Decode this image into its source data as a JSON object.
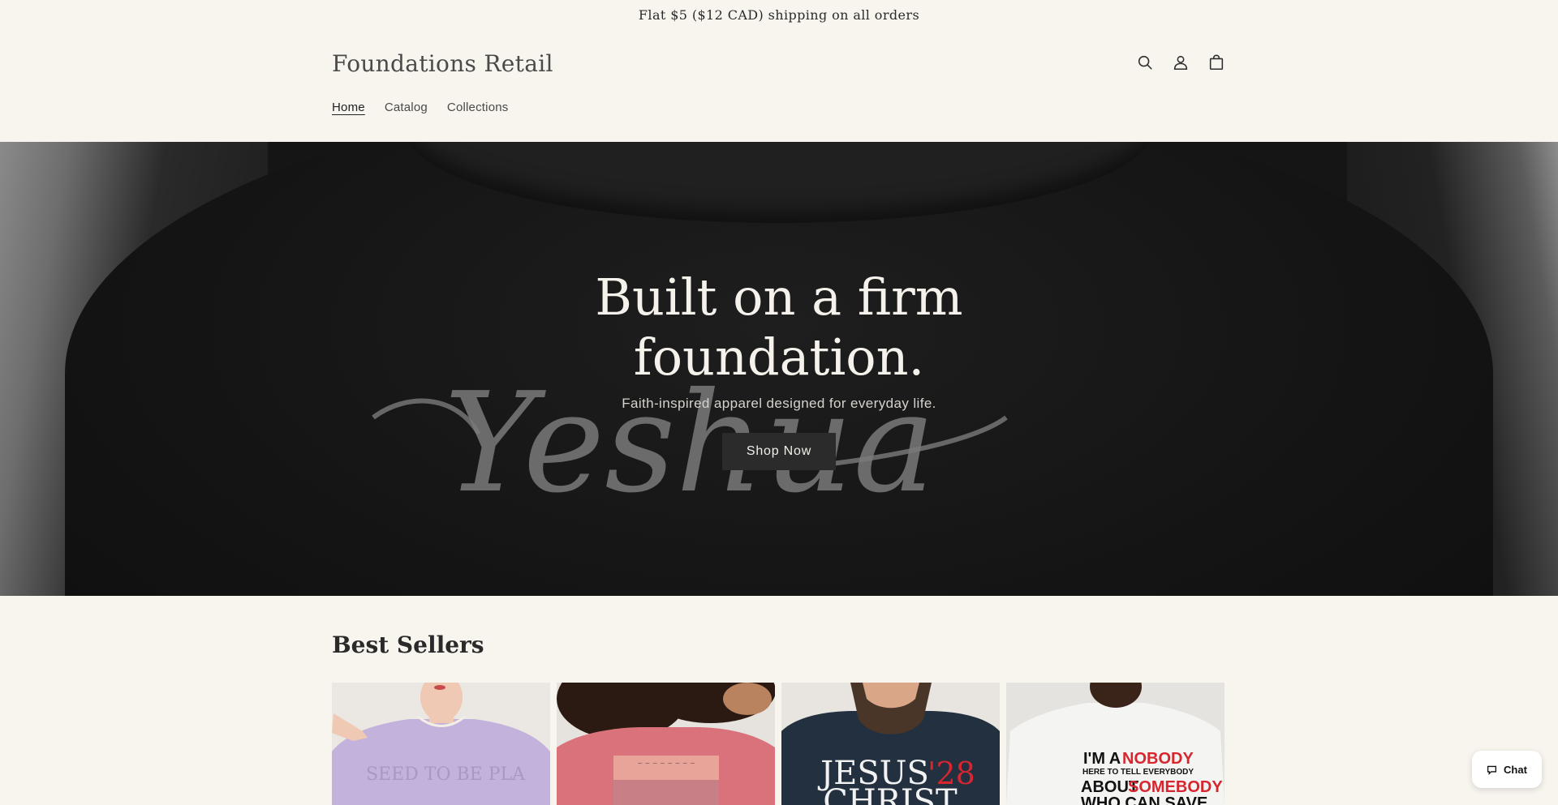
{
  "announcement": "Flat $5 ($12 CAD) shipping on all orders",
  "brand": "Foundations Retail",
  "nav": {
    "items": [
      {
        "label": "Home",
        "active": true
      },
      {
        "label": "Catalog",
        "active": false
      },
      {
        "label": "Collections",
        "active": false
      }
    ]
  },
  "header_icons": [
    "search-icon",
    "account-icon",
    "cart-icon"
  ],
  "hero": {
    "title_line1": "Built on a firm",
    "title_line2": "foundation.",
    "subtitle": "Faith-inspired apparel designed for everyday life.",
    "button": "Shop Now",
    "shirt_script": "Yeshua"
  },
  "best_sellers": {
    "title": "Best Sellers",
    "products": [
      {
        "image": "lavender-tee",
        "print": "SEED TO BE PLA",
        "color": "#c3b2dc"
      },
      {
        "image": "pink-tee",
        "color": "#d9727a"
      },
      {
        "image": "navy-tee",
        "print_line1": "JESUS",
        "print_accent": "'28",
        "print_line2": "CHRIST",
        "color": "#22303f"
      },
      {
        "image": "white-tee",
        "print_lines": [
          "I'M A",
          "NOBODY",
          "HERE TO TELL EVERYBODY",
          "ABOUT",
          "SOMEBODY",
          "WHO CAN SAVE"
        ],
        "color": "#f4f4f2"
      }
    ]
  },
  "chat": {
    "label": "Chat"
  },
  "colors": {
    "background": "#f8f5ef",
    "hero_button": "#2b2b2b",
    "accent_red": "#d7262f"
  }
}
